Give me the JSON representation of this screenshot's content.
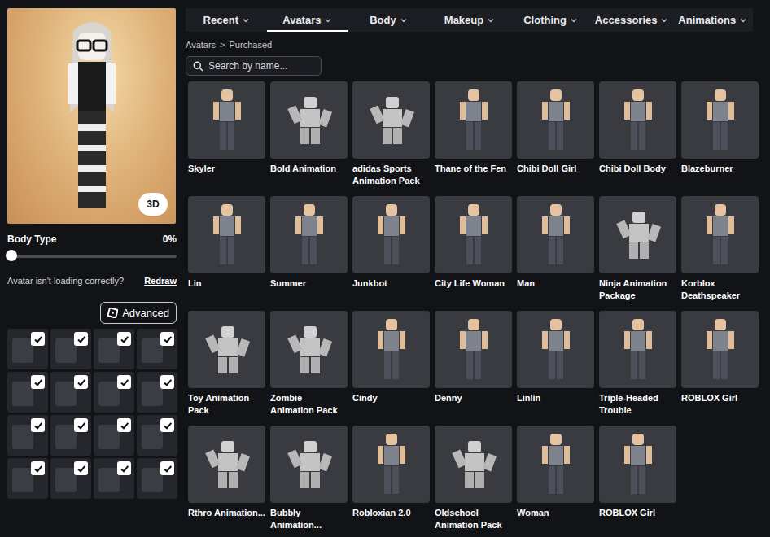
{
  "preview": {
    "view_button": "3D"
  },
  "body_type": {
    "label": "Body Type",
    "reading": "0%",
    "level": 0
  },
  "loading_help": {
    "text": "Avatar isn't loading correctly?",
    "link": "Redraw"
  },
  "advanced_button": {
    "label": "Advanced"
  },
  "worn_items": [
    {
      "checked": true
    },
    {
      "checked": true
    },
    {
      "checked": true
    },
    {
      "checked": true
    },
    {
      "checked": true
    },
    {
      "checked": true
    },
    {
      "checked": true
    },
    {
      "checked": true
    },
    {
      "checked": true
    },
    {
      "checked": true
    },
    {
      "checked": true
    },
    {
      "checked": true
    },
    {
      "checked": true
    },
    {
      "checked": true
    },
    {
      "checked": true
    },
    {
      "checked": true
    }
  ],
  "tabs": [
    {
      "label": "Recent",
      "selected": false
    },
    {
      "label": "Avatars",
      "selected": true
    },
    {
      "label": "Body",
      "selected": false
    },
    {
      "label": "Makeup",
      "selected": false
    },
    {
      "label": "Clothing",
      "selected": false
    },
    {
      "label": "Accessories",
      "selected": false
    },
    {
      "label": "Animations",
      "selected": false
    }
  ],
  "breadcrumb": [
    "Avatars",
    ">",
    "Purchased"
  ],
  "search": {
    "placeholder": "Search by name..."
  },
  "items": [
    {
      "name": "Skyler",
      "kind": "character"
    },
    {
      "name": "Bold Animation",
      "kind": "animation"
    },
    {
      "name": "adidas Sports Animation Pack",
      "kind": "animation"
    },
    {
      "name": "Thane of the Fen",
      "kind": "character"
    },
    {
      "name": "Chibi Doll Girl",
      "kind": "character"
    },
    {
      "name": "Chibi Doll Body",
      "kind": "character"
    },
    {
      "name": "Blazeburner",
      "kind": "character"
    },
    {
      "name": "Lin",
      "kind": "character"
    },
    {
      "name": "Summer",
      "kind": "character"
    },
    {
      "name": "Junkbot",
      "kind": "character"
    },
    {
      "name": "City Life Woman",
      "kind": "character"
    },
    {
      "name": "Man",
      "kind": "character"
    },
    {
      "name": "Ninja Animation Package",
      "kind": "animation"
    },
    {
      "name": "Korblox Deathspeaker",
      "kind": "character"
    },
    {
      "name": "Toy Animation Pack",
      "kind": "animation"
    },
    {
      "name": "Zombie Animation Pack",
      "kind": "animation"
    },
    {
      "name": "Cindy",
      "kind": "character"
    },
    {
      "name": "Denny",
      "kind": "character"
    },
    {
      "name": "Linlin",
      "kind": "character"
    },
    {
      "name": "Triple-Headed Trouble",
      "kind": "character"
    },
    {
      "name": "ROBLOX Girl",
      "kind": "character"
    },
    {
      "name": "Rthro Animation...",
      "kind": "animation"
    },
    {
      "name": "Bubbly Animation...",
      "kind": "animation"
    },
    {
      "name": "Robloxian 2.0",
      "kind": "character"
    },
    {
      "name": "Oldschool Animation Pack",
      "kind": "animation"
    },
    {
      "name": "Woman",
      "kind": "character"
    },
    {
      "name": "ROBLOX Girl",
      "kind": "character"
    }
  ]
}
